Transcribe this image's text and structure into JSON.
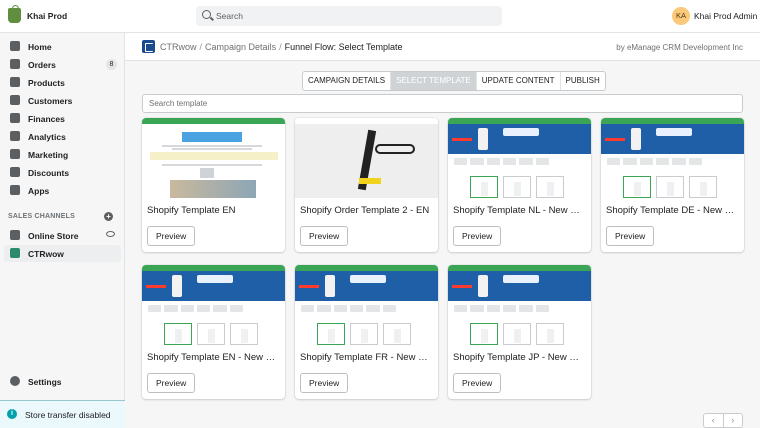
{
  "topbar": {
    "store_name": "Khai Prod",
    "search_placeholder": "Search",
    "user_initials": "KA",
    "user_name": "Khai Prod Admin"
  },
  "sidebar": {
    "items": [
      {
        "label": "Home",
        "icon": "home-icon"
      },
      {
        "label": "Orders",
        "icon": "orders-icon",
        "badge": "8"
      },
      {
        "label": "Products",
        "icon": "products-icon"
      },
      {
        "label": "Customers",
        "icon": "customers-icon"
      },
      {
        "label": "Finances",
        "icon": "finances-icon"
      },
      {
        "label": "Analytics",
        "icon": "analytics-icon"
      },
      {
        "label": "Marketing",
        "icon": "marketing-icon"
      },
      {
        "label": "Discounts",
        "icon": "discounts-icon"
      },
      {
        "label": "Apps",
        "icon": "apps-icon"
      }
    ],
    "sales_channels_title": "SALES CHANNELS",
    "channels": [
      {
        "label": "Online Store",
        "icon": "store-icon"
      },
      {
        "label": "CTRwow",
        "icon": "ctrwow-icon"
      }
    ],
    "settings_label": "Settings",
    "notice": "Store transfer disabled"
  },
  "header": {
    "breadcrumb": [
      "CTRwow",
      "Campaign Details",
      "Funnel Flow: Select Template"
    ],
    "by_text": "by eManage CRM Development Inc"
  },
  "tabs": [
    "CAMPAIGN DETAILS",
    "SELECT TEMPLATE",
    "UPDATE CONTENT",
    "PUBLISH"
  ],
  "active_tab": "SELECT TEMPLATE",
  "template_search_placeholder": "Search template",
  "templates": [
    {
      "title": "Shopify Template EN",
      "button": "Preview"
    },
    {
      "title": "Shopify Order Template 2 - EN",
      "button": "Preview"
    },
    {
      "title": "Shopify Template NL - New GS ...",
      "button": "Preview"
    },
    {
      "title": "Shopify Template DE - New GS ...",
      "button": "Preview"
    },
    {
      "title": "Shopify Template EN - New GS ...",
      "button": "Preview"
    },
    {
      "title": "Shopify Template FR - New GS ...",
      "button": "Preview"
    },
    {
      "title": "Shopify Template JP - New GS ...",
      "button": "Preview"
    }
  ],
  "pager": {
    "prev": "‹",
    "next": "›"
  },
  "colors": {
    "accent_green": "#3aa655",
    "brand_blue": "#1f5fa8"
  }
}
